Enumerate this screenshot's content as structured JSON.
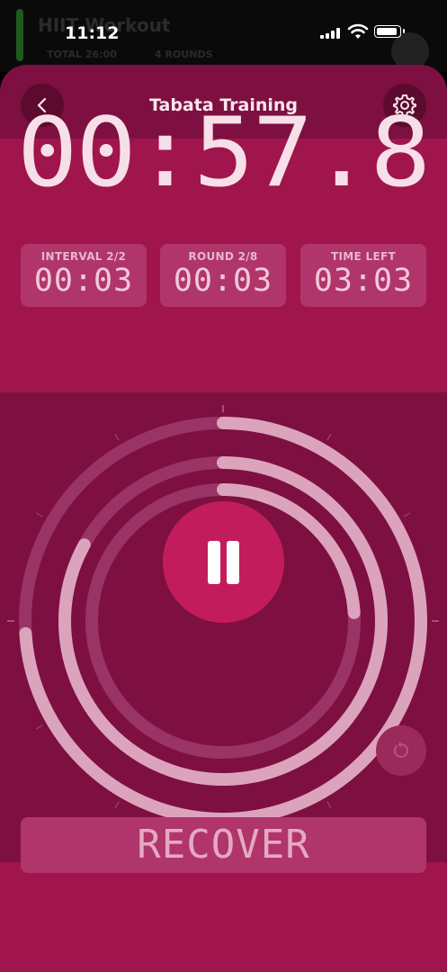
{
  "status_bar": {
    "time": "11:12"
  },
  "background_app": {
    "title": "HIIT Workout",
    "total": "TOTAL 26:00",
    "rounds": "4 ROUNDS"
  },
  "header": {
    "title": "Tabata Training"
  },
  "timer": {
    "main": "00:57.8"
  },
  "stats": [
    {
      "label": "INTERVAL 2/2",
      "value": "00:03"
    },
    {
      "label": "ROUND 2/8",
      "value": "00:03"
    },
    {
      "label": "TIME LEFT",
      "value": "03:03"
    }
  ],
  "progress": {
    "outer_ring": 0.74,
    "middle_ring": 0.83,
    "inner_ring": 0.24
  },
  "footer": {
    "button_label": "RECOVER"
  },
  "colors": {
    "sheet": "#7d1040",
    "panel": "#a0154c",
    "accent": "#c31c5d",
    "tile": "#b0356b",
    "text": "#f6dfe8"
  },
  "icons": [
    "back-icon",
    "gear-icon",
    "pause-icon",
    "reset-icon",
    "wifi-icon",
    "battery-icon",
    "signal-icon"
  ]
}
